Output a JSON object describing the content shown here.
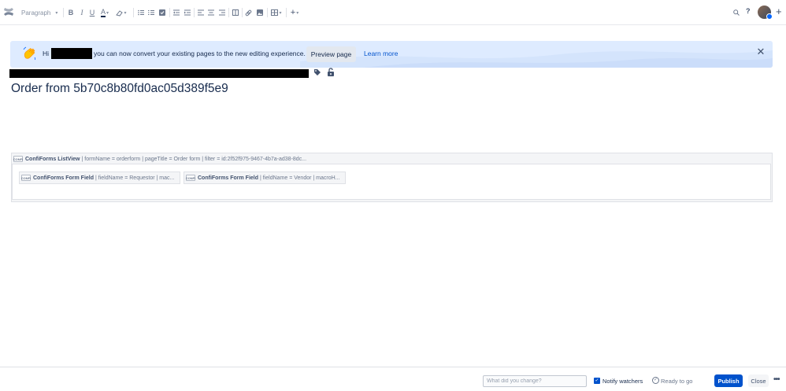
{
  "toolbar": {
    "paragraph_style": "Paragraph",
    "caret": "▾",
    "icons": [
      "confluence-logo",
      "bold-icon",
      "italic-icon",
      "underline-icon",
      "text-color-icon",
      "format-clear-icon",
      "bullet-list-icon",
      "numbered-list-icon",
      "task-list-icon",
      "outdent-icon",
      "indent-icon",
      "align-left-icon",
      "align-center-icon",
      "align-right-icon",
      "layout-icon",
      "link-icon",
      "image-icon",
      "table-icon",
      "insert-more-icon",
      "search-icon",
      "help-icon",
      "avatar",
      "create-icon"
    ]
  },
  "banner": {
    "greeting": "Hi",
    "message": "you can now convert your existing pages to the new editing experience.",
    "preview_label": "Preview page",
    "learn_more_label": "Learn more"
  },
  "page": {
    "title": "Order from 5b70c8b80fd0ac05d389f5e9"
  },
  "macro": {
    "icon_text": "CONFI",
    "name": "ConfiForms ListView",
    "params": " | formName = orderform | pageTitle = Order form | filter = id:2f52f975-9467-4b7a-ad38-8dc...",
    "fields": [
      {
        "name": "ConfiForms Form Field",
        "params": " | fieldName = Requestor | mac..."
      },
      {
        "name": "ConfiForms Form Field",
        "params": " | fieldName = Vendor | macroH..."
      }
    ]
  },
  "footer": {
    "change_placeholder": "What did you change?",
    "notify_label": "Notify watchers",
    "notify_checked": true,
    "ready_label": "Ready to go",
    "publish_label": "Publish",
    "close_label": "Close",
    "more_label": "•••"
  },
  "colors": {
    "primary": "#0052cc",
    "banner_bg": "#deebff",
    "text": "#172b4d"
  }
}
